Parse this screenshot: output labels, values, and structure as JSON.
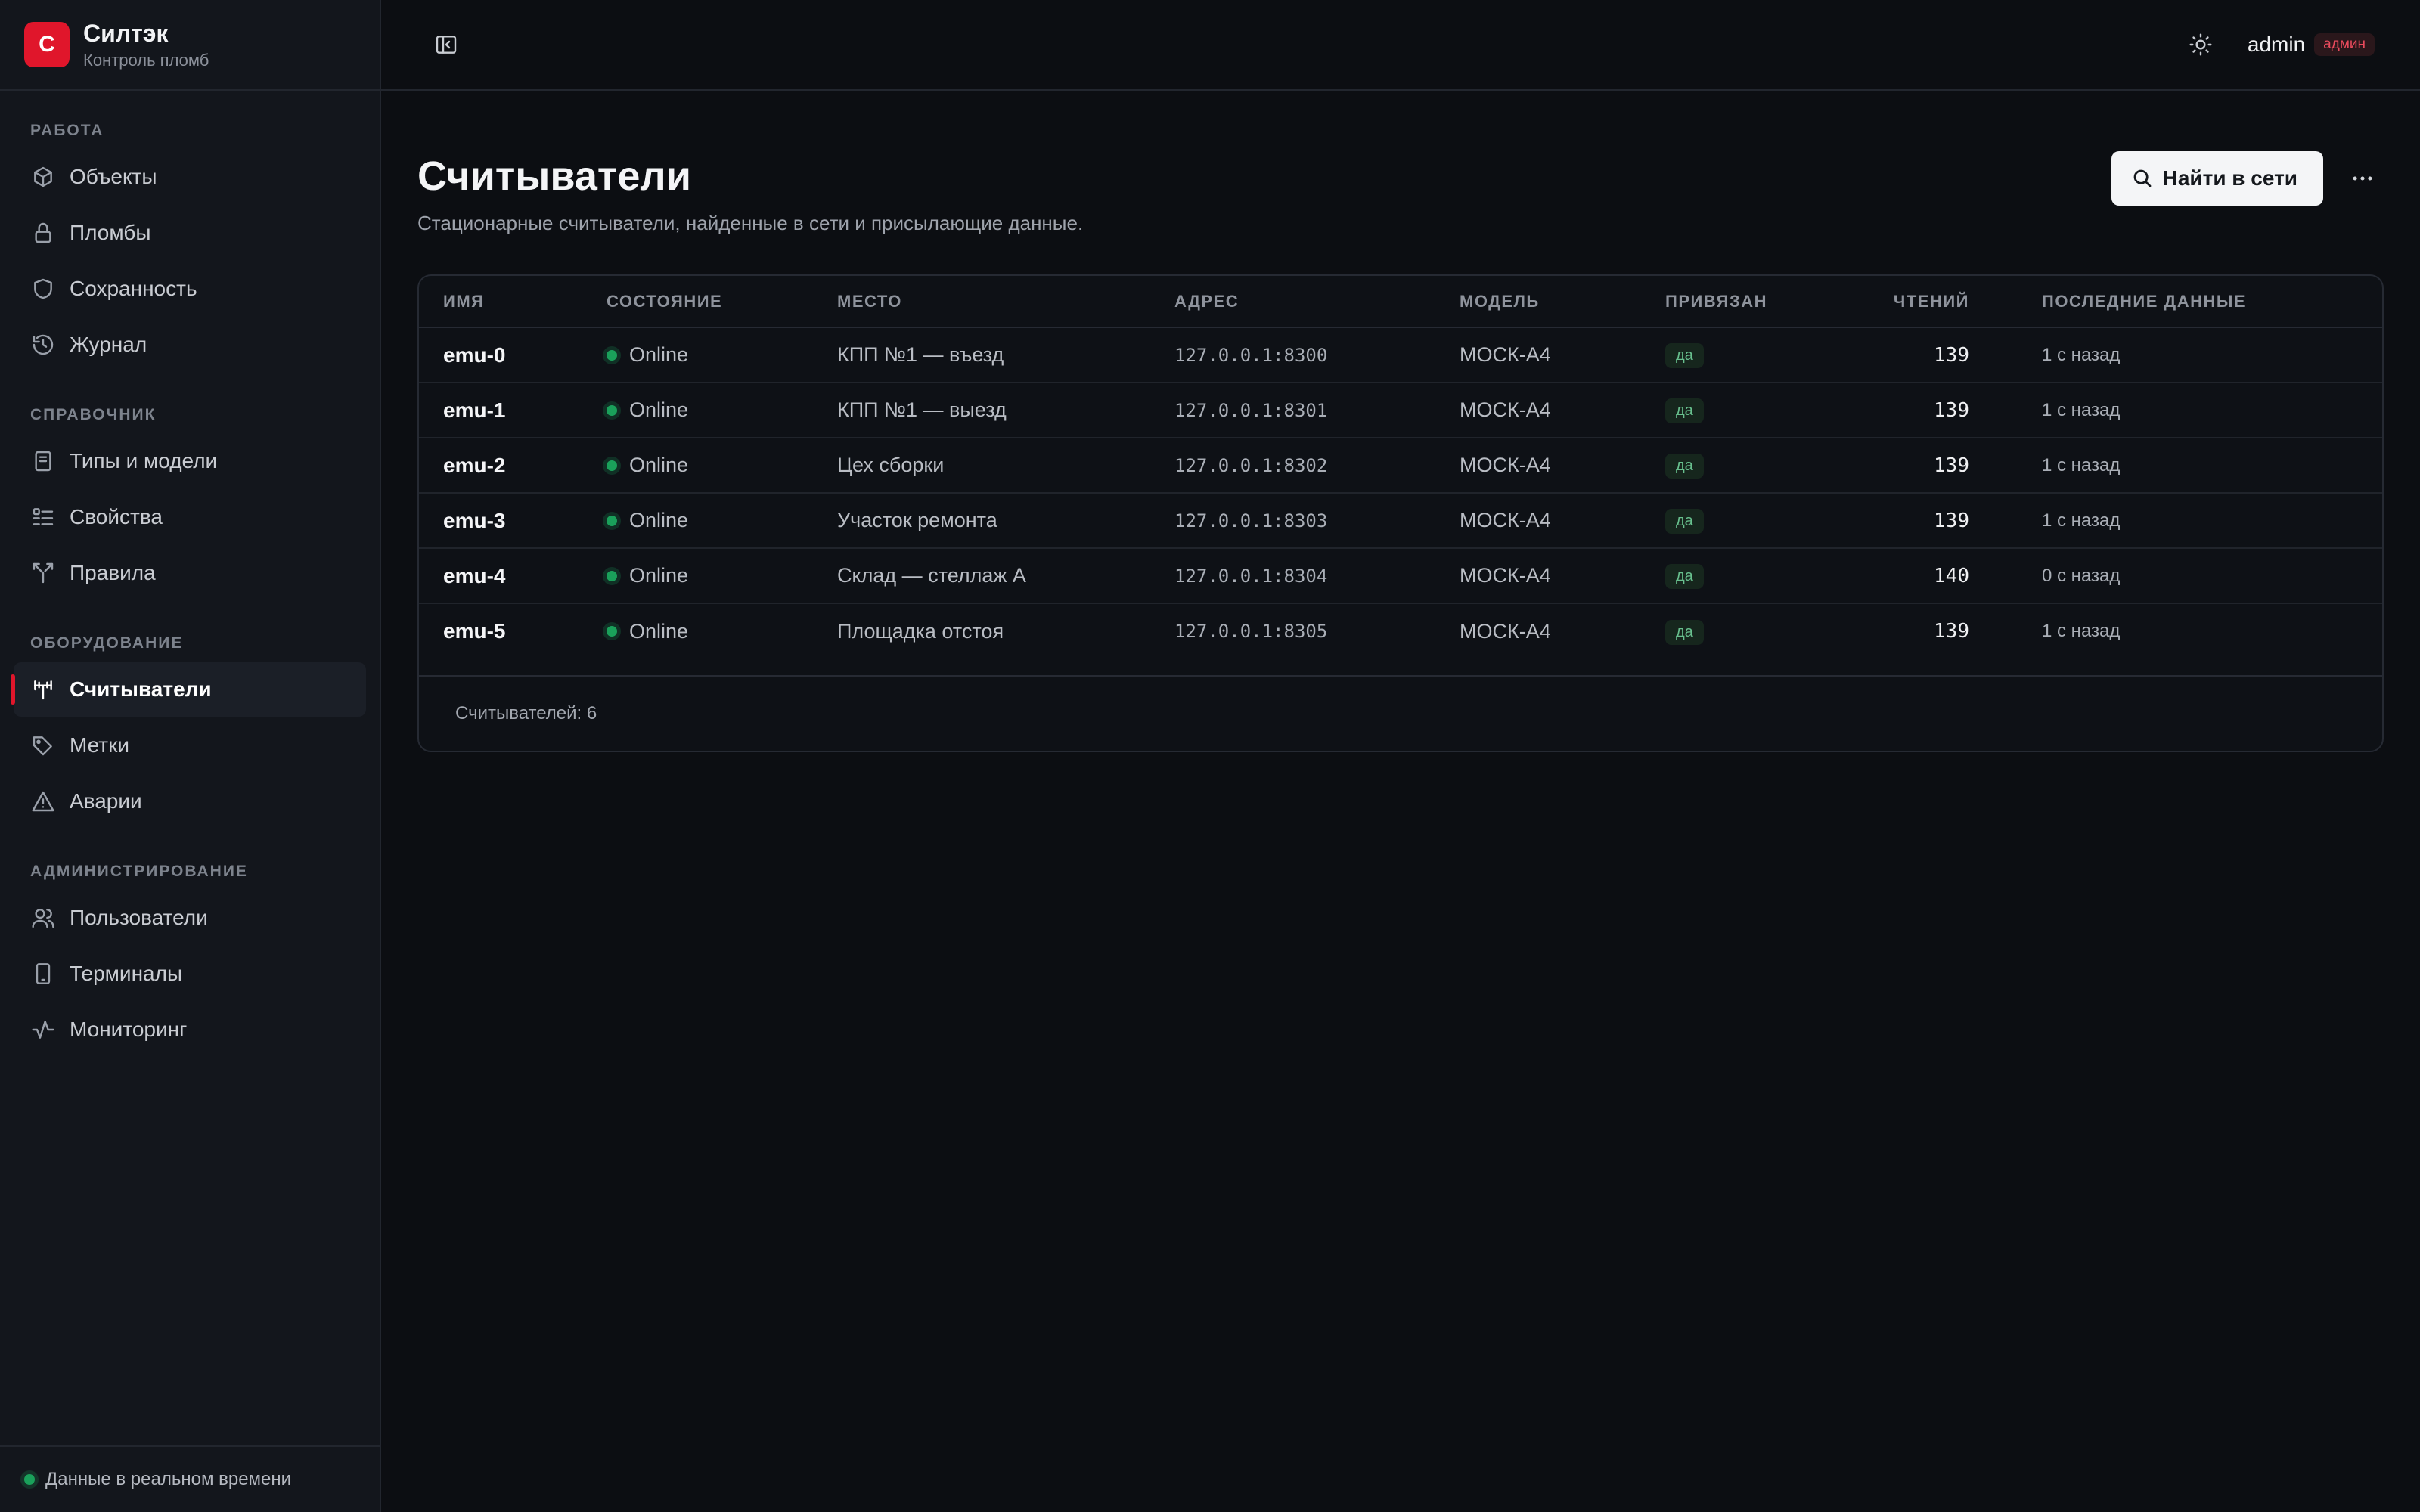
{
  "brand": {
    "logo_letter": "C",
    "name": "Силтэк",
    "subtitle": "Контроль пломб",
    "accent": "#e0162b"
  },
  "nav": [
    {
      "heading": "РАБОТА",
      "items": [
        {
          "label": "Объекты",
          "icon": "cube-icon"
        },
        {
          "label": "Пломбы",
          "icon": "lock-icon"
        },
        {
          "label": "Сохранность",
          "icon": "shield-icon"
        },
        {
          "label": "Журнал",
          "icon": "history-icon"
        }
      ]
    },
    {
      "heading": "СПРАВОЧНИК",
      "items": [
        {
          "label": "Типы и модели",
          "icon": "book-icon"
        },
        {
          "label": "Свойства",
          "icon": "list-icon"
        },
        {
          "label": "Правила",
          "icon": "split-icon"
        }
      ]
    },
    {
      "heading": "ОБОРУДОВАНИЕ",
      "items": [
        {
          "label": "Считыватели",
          "icon": "antenna-icon",
          "active": true
        },
        {
          "label": "Метки",
          "icon": "tags-icon"
        },
        {
          "label": "Аварии",
          "icon": "warning-icon"
        }
      ]
    },
    {
      "heading": "АДМИНИСТРИРОВАНИЕ",
      "items": [
        {
          "label": "Пользователи",
          "icon": "users-icon"
        },
        {
          "label": "Терминалы",
          "icon": "tablet-icon"
        },
        {
          "label": "Мониторинг",
          "icon": "pulse-icon"
        }
      ]
    }
  ],
  "footer": {
    "status_text": "Данные в реальном времени",
    "status_color": "#1aa05a"
  },
  "topbar": {
    "user_name": "admin",
    "role_badge": "админ"
  },
  "page": {
    "title": "Считыватели",
    "description": "Стационарные считыватели, найденные в сети и присылающие данные.",
    "primary_action": "Найти в сети"
  },
  "table": {
    "columns": [
      "ИМЯ",
      "СОСТОЯНИЕ",
      "МЕСТО",
      "АДРЕС",
      "МОДЕЛЬ",
      "ПРИВЯЗАН",
      "ЧТЕНИЙ",
      "ПОСЛЕДНИЕ ДАННЫЕ"
    ],
    "rows": [
      {
        "name": "emu-0",
        "state": "Online",
        "place": "КПП №1 — въезд",
        "address": "127.0.0.1:8300",
        "model": "МОСК-А4",
        "bound": "да",
        "reads": "139",
        "last": "1 с назад"
      },
      {
        "name": "emu-1",
        "state": "Online",
        "place": "КПП №1 — выезд",
        "address": "127.0.0.1:8301",
        "model": "МОСК-А4",
        "bound": "да",
        "reads": "139",
        "last": "1 с назад"
      },
      {
        "name": "emu-2",
        "state": "Online",
        "place": "Цех сборки",
        "address": "127.0.0.1:8302",
        "model": "МОСК-А4",
        "bound": "да",
        "reads": "139",
        "last": "1 с назад"
      },
      {
        "name": "emu-3",
        "state": "Online",
        "place": "Участок ремонта",
        "address": "127.0.0.1:8303",
        "model": "МОСК-А4",
        "bound": "да",
        "reads": "139",
        "last": "1 с назад"
      },
      {
        "name": "emu-4",
        "state": "Online",
        "place": "Склад — стеллаж А",
        "address": "127.0.0.1:8304",
        "model": "МОСК-А4",
        "bound": "да",
        "reads": "140",
        "last": "0 с назад"
      },
      {
        "name": "emu-5",
        "state": "Online",
        "place": "Площадка отстоя",
        "address": "127.0.0.1:8305",
        "model": "МОСК-А4",
        "bound": "да",
        "reads": "139",
        "last": "1 с назад"
      }
    ],
    "footer": "Считывателей: 6",
    "online_color": "#1aa05a"
  }
}
